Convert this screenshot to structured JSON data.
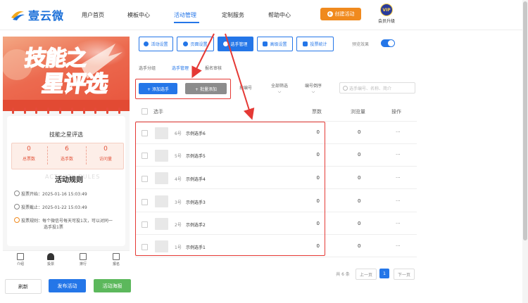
{
  "header": {
    "logo_text": "壹云微",
    "nav": [
      "用户首页",
      "模板中心",
      "活动管理",
      "定制服务",
      "帮助中心"
    ],
    "active_nav": "活动管理",
    "create_button": "创建活动",
    "vip_badge": "VIP",
    "vip_label": "会员升级"
  },
  "preview": {
    "banner_line1": "技能之",
    "banner_line2": "星评选",
    "title": "技能之星评选",
    "stats": [
      {
        "value": "0",
        "label": "总票数"
      },
      {
        "value": "6",
        "label": "选手数"
      },
      {
        "value": "0",
        "label": "访问量"
      }
    ],
    "rules_watermark": "ACTIVITY RULES",
    "rules_title": "活动规则",
    "rules": [
      "投票开始：2025-01-16 15:03:49",
      "投票截止：2025-01-22 15:03:49",
      "投票规则：每个微信号每天可投1次，可以对同一",
      "选手投1票"
    ],
    "tabs": [
      "介绍",
      "投票",
      "排行",
      "报名"
    ]
  },
  "bottom_buttons": {
    "refresh": "刷新",
    "publish": "发布活动",
    "poster": "活动海报"
  },
  "toolbar": [
    "活动设置",
    "页面设置",
    "选手管理",
    "高级设置",
    "投票统计"
  ],
  "toolbar_active": "选手管理",
  "preview_toggle_label": "预览效果",
  "subtabs": [
    "选手分组",
    "选手管理",
    "报名审核"
  ],
  "actions": {
    "add": "+ 添加选手",
    "batch": "+ 批量添加"
  },
  "filters": [
    {
      "line1": "按编号",
      "line2": ""
    },
    {
      "line1": "全部筛选",
      "line2": "⌵"
    },
    {
      "line1": "编号倒序",
      "line2": "⌵"
    }
  ],
  "search_placeholder": "选手编号、名称、简介",
  "table": {
    "headers": [
      "选手",
      "票数",
      "浏览量",
      "操作"
    ],
    "rows": [
      {
        "no": "6号",
        "name": "示例选手6",
        "votes": "0",
        "views": "0",
        "more": "···"
      },
      {
        "no": "5号",
        "name": "示例选手5",
        "votes": "0",
        "views": "0",
        "more": "···"
      },
      {
        "no": "4号",
        "name": "示例选手4",
        "votes": "0",
        "views": "0",
        "more": "···"
      },
      {
        "no": "3号",
        "name": "示例选手3",
        "votes": "0",
        "views": "0",
        "more": "···"
      },
      {
        "no": "2号",
        "name": "示例选手2",
        "votes": "0",
        "views": "0",
        "more": "···"
      },
      {
        "no": "1号",
        "name": "示例选手1",
        "votes": "0",
        "views": "0",
        "more": "···"
      }
    ]
  },
  "pagination": {
    "total": "共 6 条",
    "prev": "上一页",
    "current": "1",
    "next": "下一页"
  },
  "colors": {
    "primary": "#2476e8",
    "accent_orange": "#f08a1e",
    "highlight_red": "#e53935",
    "poster_green": "#5cb85c"
  }
}
